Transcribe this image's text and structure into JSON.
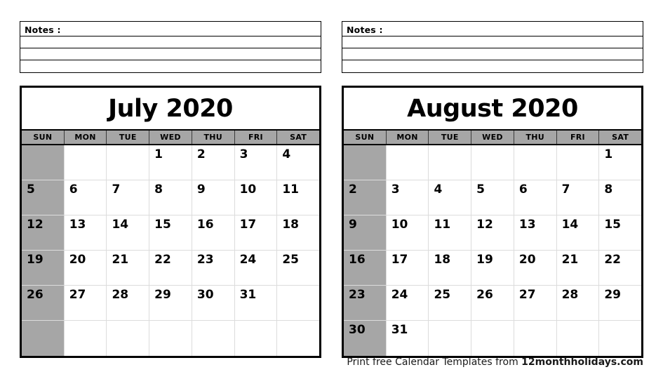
{
  "document": {
    "type": "printable-calendar",
    "year": "2020"
  },
  "notes": {
    "label": "Notes :",
    "blank_line_count": 3
  },
  "weekdays": [
    "SUN",
    "MON",
    "TUE",
    "WED",
    "THU",
    "FRI",
    "SAT"
  ],
  "colors": {
    "gray_fill": "#a6a6a6",
    "border": "#000000",
    "grid_line": "#dcdcdc",
    "text": "#000000",
    "page_background": "#ffffff"
  },
  "months": [
    {
      "title": "July 2020",
      "name": "July",
      "year": "2020",
      "first_weekday_index": 3,
      "days_in_month": 31,
      "weeks": [
        [
          "",
          "",
          "",
          "1",
          "2",
          "3",
          "4"
        ],
        [
          "5",
          "6",
          "7",
          "8",
          "9",
          "10",
          "11"
        ],
        [
          "12",
          "13",
          "14",
          "15",
          "16",
          "17",
          "18"
        ],
        [
          "19",
          "20",
          "21",
          "22",
          "23",
          "24",
          "25"
        ],
        [
          "26",
          "27",
          "28",
          "29",
          "30",
          "31",
          ""
        ],
        [
          "",
          "",
          "",
          "",
          "",
          "",
          ""
        ]
      ]
    },
    {
      "title": "August 2020",
      "name": "August",
      "year": "2020",
      "first_weekday_index": 6,
      "days_in_month": 31,
      "weeks": [
        [
          "",
          "",
          "",
          "",
          "",
          "",
          "1"
        ],
        [
          "2",
          "3",
          "4",
          "5",
          "6",
          "7",
          "8"
        ],
        [
          "9",
          "10",
          "11",
          "12",
          "13",
          "14",
          "15"
        ],
        [
          "16",
          "17",
          "18",
          "19",
          "20",
          "21",
          "22"
        ],
        [
          "23",
          "24",
          "25",
          "26",
          "27",
          "28",
          "29"
        ],
        [
          "30",
          "31",
          "",
          "",
          "",
          "",
          ""
        ]
      ]
    }
  ],
  "footer": {
    "prefix": "Print free Calendar Templates from ",
    "brand": "12monthholidays.com"
  }
}
